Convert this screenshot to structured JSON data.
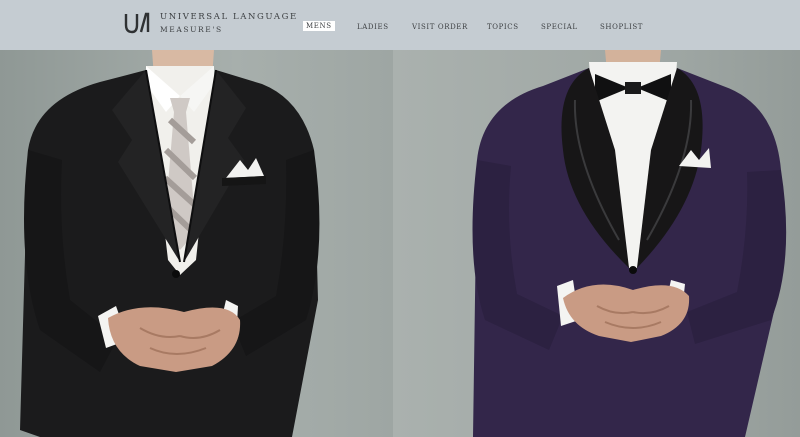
{
  "brand": {
    "logo_icon": "ul-monogram-icon",
    "line1": "UNIVERSAL LANGUAGE",
    "line2": "MEASURE'S"
  },
  "nav": {
    "items": [
      {
        "label": "MENS",
        "active": true
      },
      {
        "label": "LADIES"
      },
      {
        "label": "VISIT ORDER"
      },
      {
        "label": "TOPICS"
      },
      {
        "label": "SPECIAL"
      },
      {
        "label": "SHOPLIST"
      }
    ]
  },
  "colors": {
    "header_bg": "#c5ccd2",
    "backdrop": "#9ea6a3",
    "active_tab_bg": "#ffffff",
    "nav_text": "#3c3f42",
    "black_suit": "#1b1b1c",
    "tuxedo_purple": "#33264a"
  },
  "hero": {
    "panels": [
      {
        "subject": "black-business-suit"
      },
      {
        "subject": "purple-shawl-collar-tuxedo"
      }
    ]
  }
}
